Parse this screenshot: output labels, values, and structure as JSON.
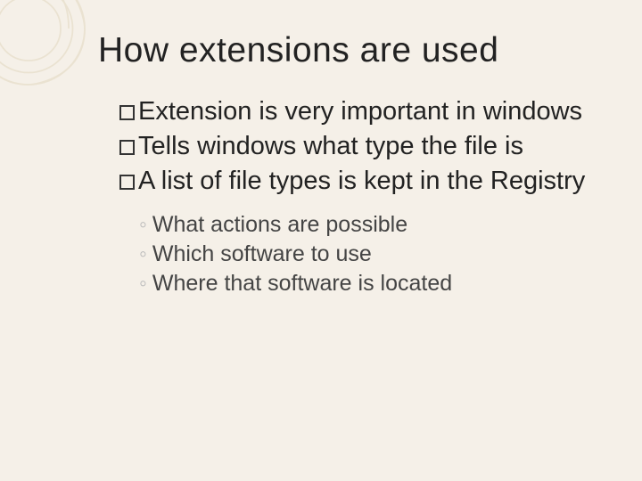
{
  "slide": {
    "title": "How extensions are used",
    "bullets": {
      "0": "Extension is very important in windows",
      "1": "Tells windows what type the file is",
      "2": "A list of file types is kept in the Registry"
    },
    "sub_bullets": {
      "0": "What actions are possible",
      "1": "Which software to use",
      "2": "Where that software is located"
    }
  }
}
